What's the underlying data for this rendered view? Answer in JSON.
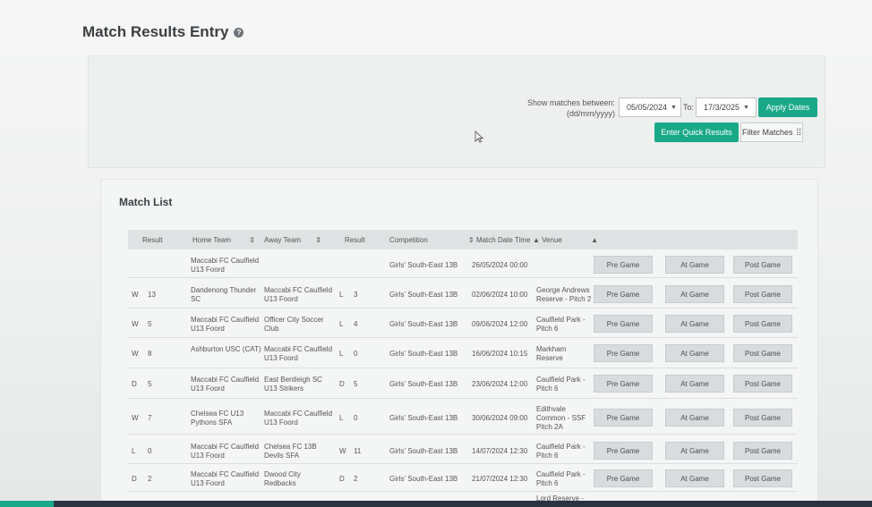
{
  "header": {
    "title": "Match Results Entry"
  },
  "filters": {
    "show_label_line1": "Show matches between:",
    "show_label_line2": "(dd/mm/yyyy)",
    "from_date": "05/05/2024",
    "to_label": "To:",
    "to_date": "17/3/2025",
    "apply_label": "Apply Dates",
    "quick_label": "Enter Quick Results",
    "filter_label": "Filter Matches",
    "filter_icon": "sliders-icon"
  },
  "match_list": {
    "title": "Match List",
    "columns": [
      "Result",
      "Home Team",
      "Away Team",
      "Result",
      "Competition",
      "Match Date Time",
      "Venue"
    ],
    "buttons": {
      "pre": "Pre Game",
      "at": "At Game",
      "post": "Post Game"
    },
    "rows": [
      {
        "hr": "",
        "hs": "",
        "home": [
          "Maccabi FC Caulfield",
          "U13 Foord"
        ],
        "away": [
          "",
          ""
        ],
        "ar": "",
        "as": "",
        "comp": "Girls' South-East 13B",
        "date": "26/05/2024 00:00",
        "venue": [
          "",
          "",
          ""
        ]
      },
      {
        "hr": "W",
        "hs": "13",
        "home": [
          "Dandenong Thunder",
          "SC"
        ],
        "away": [
          "Maccabi FC Caulfield",
          "U13 Foord"
        ],
        "ar": "L",
        "as": "3",
        "comp": "Girls' South-East 13B",
        "date": "02/06/2024 10:00",
        "venue": [
          "George Andrews",
          "Reserve - Pitch 2",
          ""
        ]
      },
      {
        "hr": "W",
        "hs": "5",
        "home": [
          "Maccabi FC Caulfield",
          "U13 Foord"
        ],
        "away": [
          "Officer City Soccer",
          "Club"
        ],
        "ar": "L",
        "as": "4",
        "comp": "Girls' South-East 13B",
        "date": "09/06/2024 12:00",
        "venue": [
          "Caulfield Park -",
          "Pitch 6",
          ""
        ]
      },
      {
        "hr": "W",
        "hs": "8",
        "home": [
          "Ashburton USC (CAT)",
          ""
        ],
        "away": [
          "Maccabi FC Caulfield",
          "U13 Foord"
        ],
        "ar": "L",
        "as": "0",
        "comp": "Girls' South-East 13B",
        "date": "16/06/2024 10:15",
        "venue": [
          "Markham",
          "Reserve",
          ""
        ]
      },
      {
        "hr": "D",
        "hs": "5",
        "home": [
          "Maccabi FC Caulfield",
          "U13 Foord"
        ],
        "away": [
          "East Bentleigh SC",
          "U13 Strikers"
        ],
        "ar": "D",
        "as": "5",
        "comp": "Girls' South-East 13B",
        "date": "23/06/2024 12:00",
        "venue": [
          "Caulfield Park -",
          "Pitch 6",
          ""
        ]
      },
      {
        "hr": "W",
        "hs": "7",
        "home": [
          "Chelsea FC U13",
          "Pythons SFA"
        ],
        "away": [
          "Maccabi FC Caulfield",
          "U13 Foord"
        ],
        "ar": "L",
        "as": "0",
        "comp": "Girls' South-East 13B",
        "date": "30/06/2024 09:00",
        "venue": [
          "Edithvale",
          "Common - SSF",
          "Pitch 2A"
        ]
      },
      {
        "hr": "L",
        "hs": "0",
        "home": [
          "Maccabi FC Caulfield",
          "U13 Foord"
        ],
        "away": [
          "Chelsea FC 13B",
          "Devils SFA"
        ],
        "ar": "W",
        "as": "11",
        "comp": "Girls' South-East 13B",
        "date": "14/07/2024 12:30",
        "venue": [
          "Caulfield Park -",
          "Pitch 6",
          ""
        ]
      },
      {
        "hr": "D",
        "hs": "2",
        "home": [
          "Maccabi FC Caulfield",
          "U13 Foord"
        ],
        "away": [
          "Dwood City",
          "Redbacks"
        ],
        "ar": "D",
        "as": "2",
        "comp": "Girls' South-East 13B",
        "date": "21/07/2024 12:30",
        "venue": [
          "Caulfield Park -",
          "Pitch 6",
          ""
        ]
      },
      {
        "hr": "",
        "hs": "",
        "home": [
          "",
          ""
        ],
        "away": [
          "",
          ""
        ],
        "ar": "",
        "as": "",
        "comp": "",
        "date": "",
        "venue": [
          "Lord Reserve -",
          "",
          ""
        ]
      }
    ]
  }
}
